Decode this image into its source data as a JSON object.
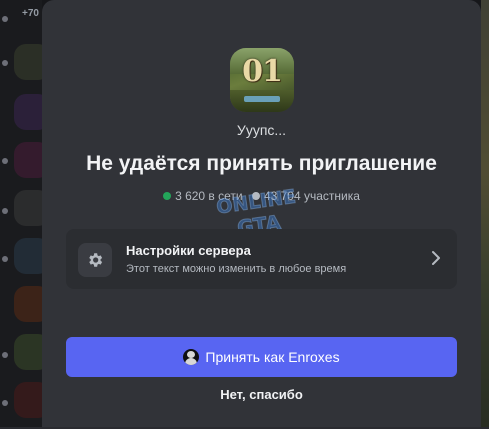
{
  "background": {
    "top_badge": "+70"
  },
  "invite": {
    "server_name": "Ууупс...",
    "title": "Не удаётся принять приглашение",
    "online_count": "3 620 в сети",
    "member_count": "43 704 участника",
    "online_color": "#23a55a",
    "members_color": "#b5bac1"
  },
  "settings_card": {
    "title": "Настройки сервера",
    "subtitle": "Этот текст можно изменить в любое время",
    "icon": "gear-icon"
  },
  "actions": {
    "accept_label": "Принять как Enroxes",
    "decline_label": "Нет, спасибо",
    "accent_color": "#5865f2"
  }
}
